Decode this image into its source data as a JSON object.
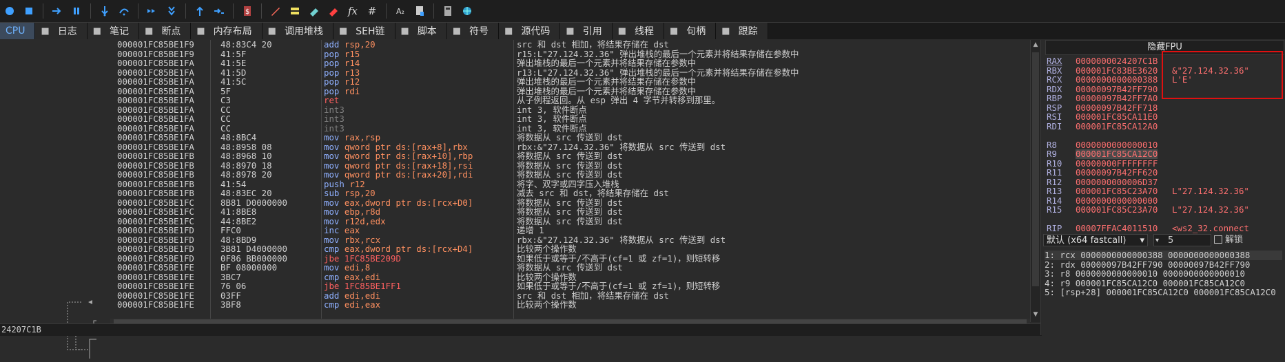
{
  "toolbar": {
    "icons": [
      "run-icon",
      "stop-icon",
      "step-forward-icon",
      "pause-icon",
      "step-into-icon",
      "step-over-icon",
      "trace-into-icon",
      "trace-over-icon",
      "execute-till-return-icon",
      "run-to-user-code-icon",
      "bug-icon",
      "pencil-icon",
      "highlight-icon",
      "patch-icon",
      "eraser-icon",
      "fx-icon",
      "hash-icon",
      "font-icon",
      "script-icon",
      "calculator-icon",
      "globe-icon"
    ],
    "fx_label": "fx",
    "hash_label": "#",
    "font_label": "A₂"
  },
  "tabs": [
    {
      "label": "CPU",
      "icon": "cpu-icon",
      "active": true
    },
    {
      "label": "日志",
      "icon": "log-icon"
    },
    {
      "label": "笔记",
      "icon": "notes-icon"
    },
    {
      "label": "断点",
      "icon": "breakpoint-icon"
    },
    {
      "label": "内存布局",
      "icon": "memory-map-icon"
    },
    {
      "label": "调用堆栈",
      "icon": "call-stack-icon"
    },
    {
      "label": "SEH链",
      "icon": "seh-icon"
    },
    {
      "label": "脚本",
      "icon": "script-tab-icon"
    },
    {
      "label": "符号",
      "icon": "symbols-icon"
    },
    {
      "label": "源代码",
      "icon": "source-icon"
    },
    {
      "label": "引用",
      "icon": "references-icon"
    },
    {
      "label": "线程",
      "icon": "threads-icon"
    },
    {
      "label": "句柄",
      "icon": "handles-icon"
    },
    {
      "label": "跟踪",
      "icon": "trace-icon"
    }
  ],
  "disasm": [
    {
      "addr": "000001FC85BE1F9",
      "bytes": "48:83C4 20",
      "mn": "add",
      "op": "rsp,20",
      "mc": "m-blue",
      "oc": "op-orange",
      "cmt": "src 和 dst 相加，将结果存储在 dst"
    },
    {
      "addr": "000001FC85BE1F9",
      "bytes": "41:5F",
      "mn": "pop",
      "op": "r15",
      "mc": "m-blue",
      "oc": "op-orange",
      "cmt": "r15:L\"27.124.32.36\" 弹出堆栈的最后一个元素并将结果存储在参数中"
    },
    {
      "addr": "000001FC85BE1FA",
      "bytes": "41:5E",
      "mn": "pop",
      "op": "r14",
      "mc": "m-blue",
      "oc": "op-orange",
      "cmt": "弹出堆栈的最后一个元素并将结果存储在参数中"
    },
    {
      "addr": "000001FC85BE1FA",
      "bytes": "41:5D",
      "mn": "pop",
      "op": "r13",
      "mc": "m-blue",
      "oc": "op-orange",
      "cmt": "r13:L\"27.124.32.36\" 弹出堆栈的最后一个元素并将结果存储在参数中"
    },
    {
      "addr": "000001FC85BE1FA",
      "bytes": "41:5C",
      "mn": "pop",
      "op": "r12",
      "mc": "m-blue",
      "oc": "op-orange",
      "cmt": "弹出堆栈的最后一个元素并将结果存储在参数中"
    },
    {
      "addr": "000001FC85BE1FA",
      "bytes": "5F",
      "mn": "pop",
      "op": "rdi",
      "mc": "m-blue",
      "oc": "op-orange",
      "cmt": "弹出堆栈的最后一个元素并将结果存储在参数中"
    },
    {
      "addr": "000001FC85BE1FA",
      "bytes": "C3",
      "mn": "ret",
      "op": "",
      "mc": "m-red",
      "oc": "",
      "cmt": "从子例程返回。从 esp 弹出 4 字节并转移到那里。"
    },
    {
      "addr": "000001FC85BE1FA",
      "bytes": "CC",
      "mn": "int3",
      "op": "",
      "mc": "m-gray",
      "oc": "",
      "cmt": "int 3, 软件断点"
    },
    {
      "addr": "000001FC85BE1FA",
      "bytes": "CC",
      "mn": "int3",
      "op": "",
      "mc": "m-gray",
      "oc": "",
      "cmt": "int 3, 软件断点"
    },
    {
      "addr": "000001FC85BE1FA",
      "bytes": "CC",
      "mn": "int3",
      "op": "",
      "mc": "m-gray",
      "oc": "",
      "cmt": "int 3, 软件断点"
    },
    {
      "addr": "000001FC85BE1FA",
      "bytes": "48:8BC4",
      "mn": "mov",
      "op": "rax,rsp",
      "mc": "m-blue",
      "oc": "op-orange",
      "cmt": "将数据从 src 传送到 dst"
    },
    {
      "addr": "000001FC85BE1FA",
      "bytes": "48:8958 08",
      "mn": "mov",
      "op": "qword ptr ds:[rax+8],rbx",
      "mc": "m-blue",
      "oc": "op-orange",
      "cmt": "rbx:&\"27.124.32.36\" 将数据从 src 传送到 dst"
    },
    {
      "addr": "000001FC85BE1FB",
      "bytes": "48:8968 10",
      "mn": "mov",
      "op": "qword ptr ds:[rax+10],rbp",
      "mc": "m-blue",
      "oc": "op-orange",
      "cmt": "将数据从 src 传送到 dst"
    },
    {
      "addr": "000001FC85BE1FB",
      "bytes": "48:8970 18",
      "mn": "mov",
      "op": "qword ptr ds:[rax+18],rsi",
      "mc": "m-blue",
      "oc": "op-orange",
      "cmt": "将数据从 src 传送到 dst"
    },
    {
      "addr": "000001FC85BE1FB",
      "bytes": "48:8978 20",
      "mn": "mov",
      "op": "qword ptr ds:[rax+20],rdi",
      "mc": "m-blue",
      "oc": "op-orange",
      "cmt": "将数据从 src 传送到 dst"
    },
    {
      "addr": "000001FC85BE1FB",
      "bytes": "41:54",
      "mn": "push",
      "op": "r12",
      "mc": "m-blue",
      "oc": "op-orange",
      "cmt": "将字、双字或四字压入堆栈"
    },
    {
      "addr": "000001FC85BE1FB",
      "bytes": "48:83EC 20",
      "mn": "sub",
      "op": "rsp,20",
      "mc": "m-blue",
      "oc": "op-orange",
      "cmt": "减去 src 和 dst，将结果存储在 dst"
    },
    {
      "addr": "000001FC85BE1FC",
      "bytes": "8B81 D0000000",
      "mn": "mov",
      "op": "eax,dword ptr ds:[rcx+D0]",
      "mc": "m-blue",
      "oc": "op-orange",
      "cmt": "将数据从 src 传送到 dst"
    },
    {
      "addr": "000001FC85BE1FC",
      "bytes": "41:8BE8",
      "mn": "mov",
      "op": "ebp,r8d",
      "mc": "m-blue",
      "oc": "op-orange",
      "cmt": "将数据从 src 传送到 dst"
    },
    {
      "addr": "000001FC85BE1FC",
      "bytes": "44:8BE2",
      "mn": "mov",
      "op": "r12d,edx",
      "mc": "m-blue",
      "oc": "op-orange",
      "cmt": "将数据从 src 传送到 dst"
    },
    {
      "addr": "000001FC85BE1FD",
      "bytes": "FFC0",
      "mn": "inc",
      "op": "eax",
      "mc": "m-blue",
      "oc": "op-orange",
      "cmt": "递增 1"
    },
    {
      "addr": "000001FC85BE1FD",
      "bytes": "48:8BD9",
      "mn": "mov",
      "op": "rbx,rcx",
      "mc": "m-blue",
      "oc": "op-orange",
      "cmt": "rbx:&\"27.124.32.36\" 将数据从 src 传送到 dst"
    },
    {
      "addr": "000001FC85BE1FD",
      "bytes": "3B81 D4000000",
      "mn": "cmp",
      "op": "eax,dword ptr ds:[rcx+D4]",
      "mc": "m-blue",
      "oc": "op-orange",
      "cmt": "比较两个操作数"
    },
    {
      "addr": "000001FC85BE1FD",
      "bytes": "0F86 BB000000",
      "mn": "jbe",
      "op": "1FC85BE209D",
      "mc": "m-red",
      "oc": "op-red",
      "cmt": "如果低于或等于/不高于(cf=1 或 zf=1)，则短转移"
    },
    {
      "addr": "000001FC85BE1FE",
      "bytes": "BF 08000000",
      "mn": "mov",
      "op": "edi,8",
      "mc": "m-blue",
      "oc": "op-orange",
      "cmt": "将数据从 src 传送到 dst"
    },
    {
      "addr": "000001FC85BE1FE",
      "bytes": "3BC7",
      "mn": "cmp",
      "op": "eax,edi",
      "mc": "m-blue",
      "oc": "op-orange",
      "cmt": "比较两个操作数"
    },
    {
      "addr": "000001FC85BE1FE",
      "bytes": "76 06",
      "mn": "jbe",
      "op": "1FC85BE1FF1",
      "mc": "m-red",
      "oc": "op-red",
      "cmt": "如果低于或等于/不高于(cf=1 或 zf=1)，则短转移"
    },
    {
      "addr": "000001FC85BE1FE",
      "bytes": "03FF",
      "mn": "add",
      "op": "edi,edi",
      "mc": "m-blue",
      "oc": "op-orange",
      "cmt": "src 和 dst 相加，将结果存储在 dst"
    },
    {
      "addr": "000001FC85BE1FE",
      "bytes": "3BF8",
      "mn": "cmp",
      "op": "edi,eax",
      "mc": "m-blue",
      "oc": "op-orange",
      "cmt": "比较两个操作数"
    }
  ],
  "fpu": {
    "hide_label": "隐藏FPU"
  },
  "registers": [
    {
      "name": "RAX",
      "value": "0000000024207C1B",
      "comment": "",
      "ul": true
    },
    {
      "name": "RBX",
      "value": "000001FC83BE3620",
      "comment": "&\"27.124.32.36\""
    },
    {
      "name": "RCX",
      "value": "0000000000000388",
      "comment": "L'E'"
    },
    {
      "name": "RDX",
      "value": "00000097B42FF790",
      "comment": ""
    },
    {
      "name": "RBP",
      "value": "00000097B42FF7A0",
      "comment": ""
    },
    {
      "name": "RSP",
      "value": "00000097B42FF718",
      "comment": ""
    },
    {
      "name": "RSI",
      "value": "000001FC85CA11E0",
      "comment": ""
    },
    {
      "name": "RDI",
      "value": "000001FC85CA12A0",
      "comment": ""
    },
    {
      "name": "R8",
      "value": "0000000000000010",
      "comment": "",
      "gap": true
    },
    {
      "name": "R9",
      "value": "000001FC85CA12C0",
      "comment": "",
      "hl": true
    },
    {
      "name": "R10",
      "value": "00000000FFFFFFFF",
      "comment": ""
    },
    {
      "name": "R11",
      "value": "00000097B42FF620",
      "comment": ""
    },
    {
      "name": "R12",
      "value": "0000000000006D37",
      "comment": ""
    },
    {
      "name": "R13",
      "value": "000001FC85C23A70",
      "comment": "L\"27.124.32.36\""
    },
    {
      "name": "R14",
      "value": "0000000000000000",
      "comment": ""
    },
    {
      "name": "R15",
      "value": "000001FC85C23A70",
      "comment": "L\"27.124.32.36\""
    },
    {
      "name": "RIP",
      "value": "00007FFAC4011510",
      "comment": "<ws2_32.connect",
      "gap": true
    }
  ],
  "call_conv": {
    "selected": "默认 (x64 fastcall)",
    "arg_count": "5",
    "lock_label": "解锁"
  },
  "stack_args": [
    "1: rcx 0000000000000388 0000000000000388",
    "2: rdx 00000097B42FF790 00000097B42FF790",
    "3: r8 0000000000000010 0000000000000010",
    "4: r9 000001FC85CA12C0 000001FC85CA12C0",
    "5: [rsp+28] 000001FC85CA12C0 000001FC85CA12C0"
  ],
  "status": {
    "text": "24207C1B"
  }
}
